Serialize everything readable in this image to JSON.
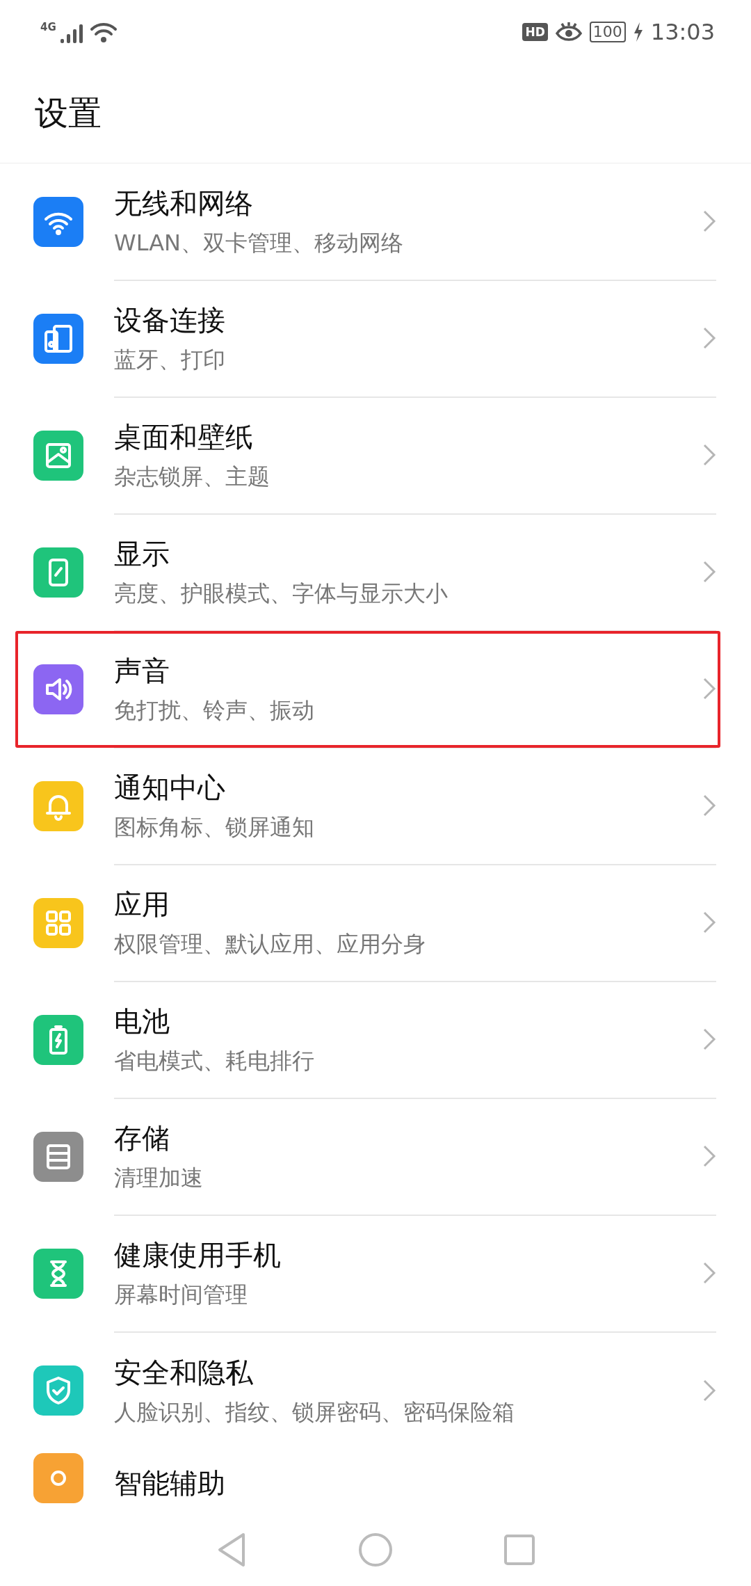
{
  "status_bar": {
    "network": "4G",
    "hd": "HD",
    "battery": "100",
    "time": "13:03"
  },
  "title": "设置",
  "items": [
    {
      "kind": "wifi",
      "title": "无线和网络",
      "subtitle": "WLAN、双卡管理、移动网络",
      "color": "#1b7ef5",
      "highlighted": false
    },
    {
      "kind": "devices",
      "title": "设备连接",
      "subtitle": "蓝牙、打印",
      "color": "#1b7ef5",
      "highlighted": false
    },
    {
      "kind": "image",
      "title": "桌面和壁纸",
      "subtitle": "杂志锁屏、主题",
      "color": "#1fc47b",
      "highlighted": false
    },
    {
      "kind": "display",
      "title": "显示",
      "subtitle": "亮度、护眼模式、字体与显示大小",
      "color": "#1fc47b",
      "highlighted": false
    },
    {
      "kind": "sound",
      "title": "声音",
      "subtitle": "免打扰、铃声、振动",
      "color": "#8c66f2",
      "highlighted": true
    },
    {
      "kind": "bell",
      "title": "通知中心",
      "subtitle": "图标角标、锁屏通知",
      "color": "#f8c51c",
      "highlighted": false
    },
    {
      "kind": "apps",
      "title": "应用",
      "subtitle": "权限管理、默认应用、应用分身",
      "color": "#f8c51c",
      "highlighted": false
    },
    {
      "kind": "battery",
      "title": "电池",
      "subtitle": "省电模式、耗电排行",
      "color": "#1fc47b",
      "highlighted": false
    },
    {
      "kind": "storage",
      "title": "存储",
      "subtitle": "清理加速",
      "color": "#8d8d8d",
      "highlighted": false
    },
    {
      "kind": "hourglass",
      "title": "健康使用手机",
      "subtitle": "屏幕时间管理",
      "color": "#1fc47b",
      "highlighted": false
    },
    {
      "kind": "shield",
      "title": "安全和隐私",
      "subtitle": "人脸识别、指纹、锁屏密码、密码保险箱",
      "color": "#1ec8b9",
      "highlighted": false
    },
    {
      "kind": "assist",
      "title": "智能辅助",
      "color": "#f7a234",
      "highlighted": false
    }
  ]
}
